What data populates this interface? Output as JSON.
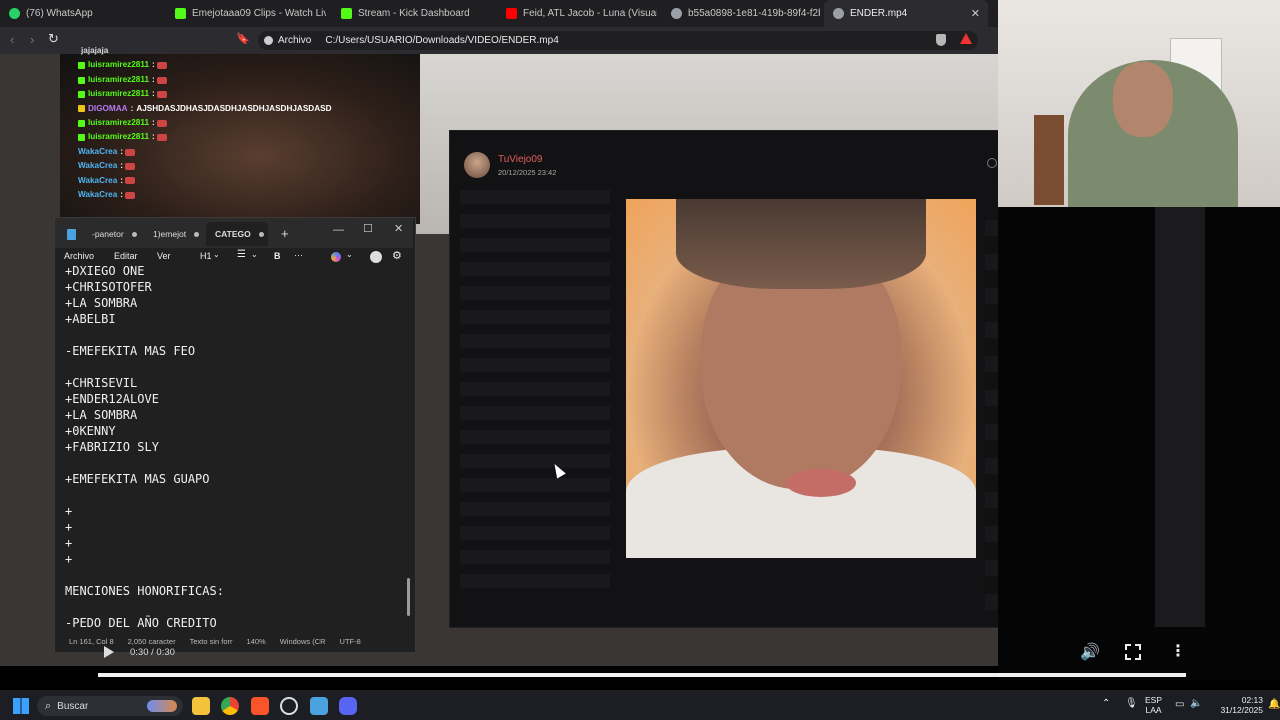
{
  "browser": {
    "tabs": [
      {
        "title": "(76) WhatsApp",
        "icon": "whatsapp-icon",
        "color": "#25d366"
      },
      {
        "title": "Emejotaaa09 Clips - Watch Live on K",
        "icon": "kick-icon",
        "color": "#53fc18"
      },
      {
        "title": "Stream - Kick Dashboard",
        "icon": "kick-icon",
        "color": "#53fc18"
      },
      {
        "title": "Feid, ATL Jacob - Luna (Visualizer) - Y",
        "icon": "youtube-icon",
        "color": "#ff0000"
      },
      {
        "title": "b55a0898-1e81-419b-89f4-f2ba830",
        "icon": "globe-icon",
        "color": "#9aa0a6"
      },
      {
        "title": "ENDER.mp4",
        "icon": "globe-icon",
        "color": "#9aa0a6"
      }
    ],
    "address_label": "Archivo",
    "url": "C:/Users/USUARIO/Downloads/VIDEO/ENDER.mp4"
  },
  "chat": {
    "messages": [
      {
        "user": "luisramirez2811",
        "color": "#53fc18",
        "text": ""
      },
      {
        "user": "luisramirez2811",
        "color": "#53fc18",
        "text": ""
      },
      {
        "user": "luisramirez2811",
        "color": "#53fc18",
        "text": ""
      },
      {
        "user": "DIGOMAA",
        "color": "#b57af0",
        "text": "AJSHDASJDHASJDASDHJASDHJASDHJASDASD"
      },
      {
        "user": "luisramirez2811",
        "color": "#53fc18",
        "text": ""
      },
      {
        "user": "luisramirez2811",
        "color": "#53fc18",
        "text": ""
      },
      {
        "user": "WakaCrea",
        "color": "#4fb3f0",
        "text": ""
      },
      {
        "user": "WakaCrea",
        "color": "#4fb3f0",
        "text": ""
      },
      {
        "user": "WakaCrea",
        "color": "#4fb3f0",
        "text": ""
      },
      {
        "user": "WakaCrea",
        "color": "#4fb3f0",
        "text": ""
      }
    ],
    "top_partial": "jajajaja"
  },
  "popup": {
    "author": "TuViejo09",
    "date": "20/12/2025 23:42"
  },
  "notepad": {
    "tabs": [
      "-panetor",
      "1)emejot",
      "CATEGO"
    ],
    "menu": [
      "Archivo",
      "Editar",
      "Ver"
    ],
    "heading": "H1",
    "text": "+DXIEGO ONE\n+CHRISOTOFER\n+LA SOMBRA\n+ABELBI\n\n-EMEFEKITA MAS FEO\n\n+CHRISEVIL\n+ENDER12ALOVE\n+LA SOMBRA\n+0KENNY\n+FABRIZIO SLY\n\n+EMEFEKITA MAS GUAPO\n\n+\n+\n+\n+\n\nMENCIONES HONORIFICAS:\n\n-PEDO DEL AÑO CREDITO",
    "status": [
      "Ln 161, Col 8",
      "2,050 caracter",
      "Texto sin forr",
      "140%",
      "Windows (CR",
      "UTF-8"
    ]
  },
  "player": {
    "time": "0:30 / 0:30",
    "progress": 1.0
  },
  "taskbar": {
    "search_label": "Buscar",
    "lang_top": "ESP",
    "lang_bottom": "LAA",
    "time": "02:13",
    "date": "31/12/2025"
  }
}
